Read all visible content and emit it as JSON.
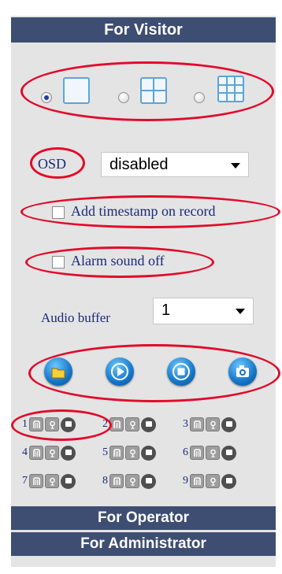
{
  "sections": {
    "visitor": "For Visitor",
    "operator": "For Operator",
    "administrator": "For Administrator"
  },
  "layout_options": [
    {
      "name": "single",
      "selected": true
    },
    {
      "name": "quad",
      "selected": false
    },
    {
      "name": "nine",
      "selected": false
    }
  ],
  "osd": {
    "label": "OSD",
    "value": "disabled"
  },
  "timestamp": {
    "label": "Add timestamp on record",
    "checked": false
  },
  "alarm": {
    "label": "Alarm sound off",
    "checked": false
  },
  "audio_buffer": {
    "label": "Audio buffer",
    "value": "1"
  },
  "controls": [
    "open-folder-icon",
    "play-icon",
    "stop-icon",
    "snapshot-icon"
  ],
  "channels": [
    {
      "num": "1"
    },
    {
      "num": "2"
    },
    {
      "num": "3"
    },
    {
      "num": "4"
    },
    {
      "num": "5"
    },
    {
      "num": "6"
    },
    {
      "num": "7"
    },
    {
      "num": "8"
    },
    {
      "num": "9"
    }
  ],
  "colors": {
    "header": "#3e4e72",
    "annotation": "#e10b2a",
    "label": "#1a2a7a",
    "accent": "#1576c8"
  }
}
